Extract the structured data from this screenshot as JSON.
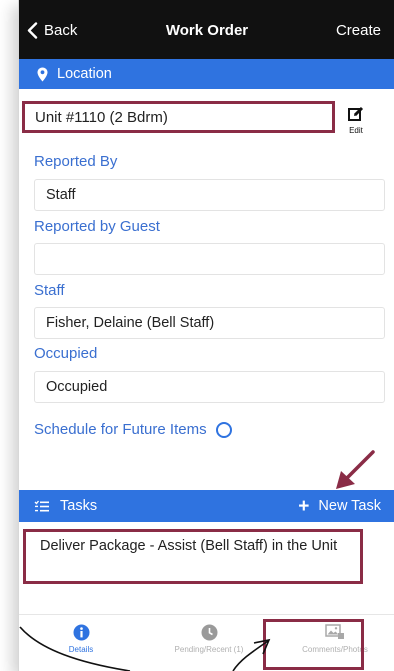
{
  "header": {
    "back_label": "Back",
    "title": "Work Order",
    "create_label": "Create"
  },
  "location": {
    "section_label": "Location",
    "unit_value": "Unit #1110 (2 Bdrm)",
    "edit_label": "Edit"
  },
  "fields": {
    "reported_by": {
      "label": "Reported By",
      "value": "Staff"
    },
    "reported_by_guest": {
      "label": "Reported by Guest",
      "value": ""
    },
    "staff": {
      "label": "Staff",
      "value": "Fisher, Delaine (Bell Staff)"
    },
    "occupied": {
      "label": "Occupied",
      "value": "Occupied"
    }
  },
  "schedule": {
    "label": "Schedule for Future Items"
  },
  "tasks": {
    "section_label": "Tasks",
    "new_task_label": "New Task",
    "items": [
      "Deliver Package - Assist (Bell Staff) in the Unit"
    ]
  },
  "tabbar": {
    "details": "Details",
    "pending": "Pending/Recent (1)",
    "comments": "Comments/Photos"
  },
  "colors": {
    "accent": "#2f73e0",
    "highlight": "#8a2c46",
    "topbar": "#111111"
  },
  "icons": [
    "chevron-left-icon",
    "map-pin-icon",
    "edit-icon",
    "task-list-icon",
    "plus-icon",
    "info-icon",
    "clock-icon",
    "photos-icon"
  ]
}
